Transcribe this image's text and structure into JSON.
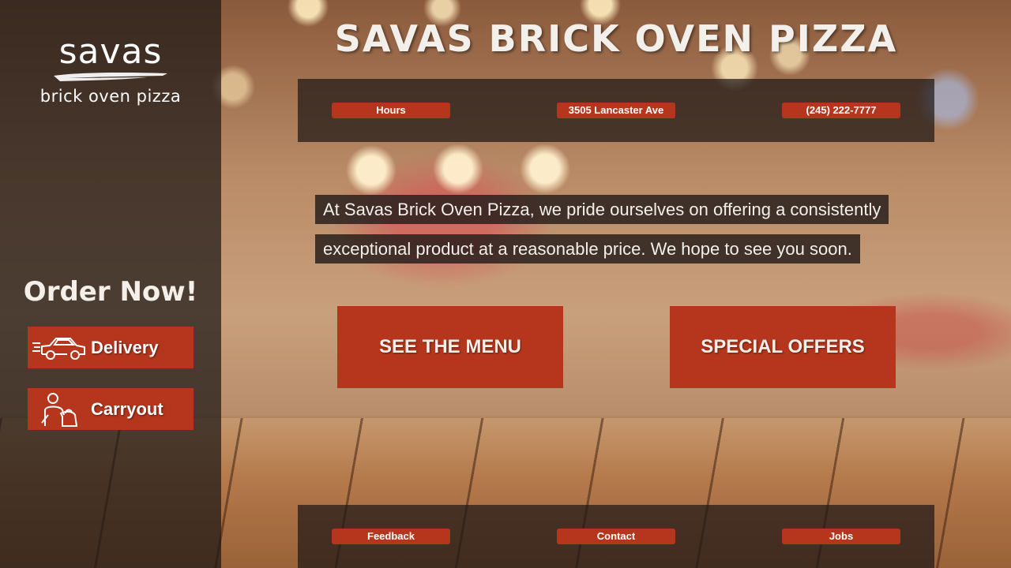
{
  "sidebar": {
    "logo": {
      "word": "savas",
      "sub": "brick oven pizza"
    },
    "order_heading": "Order Now!",
    "buttons": [
      {
        "label": "Delivery",
        "icon": "car-icon"
      },
      {
        "label": "Carryout",
        "icon": "person-carrying-bag-icon"
      }
    ]
  },
  "header": {
    "title": "SAVAS BRICK OVEN PIZZA"
  },
  "info_bar": {
    "hours": "Hours",
    "address": "3505 Lancaster Ave",
    "phone": "(245) 222-7777"
  },
  "tagline": {
    "line1": "At Savas Brick Oven Pizza, we pride ourselves on offering a consistently",
    "line2": "exceptional product at a reasonable price. We hope to see you soon."
  },
  "main_buttons": {
    "menu": "SEE THE MENU",
    "offers": "SPECIAL OFFERS"
  },
  "footer_bar": {
    "feedback": "Feedback",
    "contact": "Contact",
    "jobs": "Jobs"
  },
  "colors": {
    "accent": "#b5361d",
    "panel": "#1e1816",
    "text": "#f4efe9"
  }
}
